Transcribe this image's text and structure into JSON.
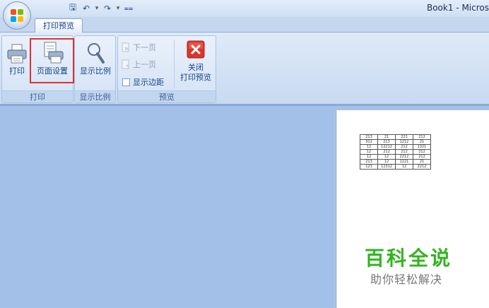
{
  "window": {
    "title": "Book1 - Micros"
  },
  "quick_access": {
    "save": "save-icon",
    "undo": "undo-icon",
    "redo": "redo-icon",
    "customize": "customize-arrow-icon",
    "glyph_save": "🖫",
    "glyph_undo": "↶",
    "glyph_redo": "↷",
    "glyph_drop": "▾",
    "glyph_customize": "₹"
  },
  "ribbon": {
    "active_tab": "打印预览",
    "groups": {
      "print": {
        "label": "打印",
        "print_button": "打印",
        "page_setup_button": "页面设置"
      },
      "zoom": {
        "label": "显示比例",
        "zoom_button": "显示比例"
      },
      "preview": {
        "label": "预览",
        "next_page": "下一页",
        "prev_page": "上一页",
        "show_margins": "显示边距",
        "close_line1": "关闭",
        "close_line2": "打印预览"
      }
    },
    "colors": {
      "highlight": "#e03131",
      "close_button": "#d9362a"
    }
  },
  "preview": {
    "table": [
      [
        "213",
        "21",
        "221",
        "212"
      ],
      [
        "312",
        "213",
        "1212",
        "21"
      ],
      [
        "12",
        "12212",
        "212",
        "1321"
      ],
      [
        "12",
        "212",
        "212",
        "212"
      ],
      [
        "12",
        "12",
        "2212",
        "212"
      ],
      [
        "213",
        "12",
        "1221",
        "21"
      ],
      [
        "123",
        "12312",
        "12",
        "2212"
      ]
    ],
    "watermark_main": "百科全说",
    "watermark_sub": "助你轻松解决",
    "watermark_color": "#32b51e"
  }
}
